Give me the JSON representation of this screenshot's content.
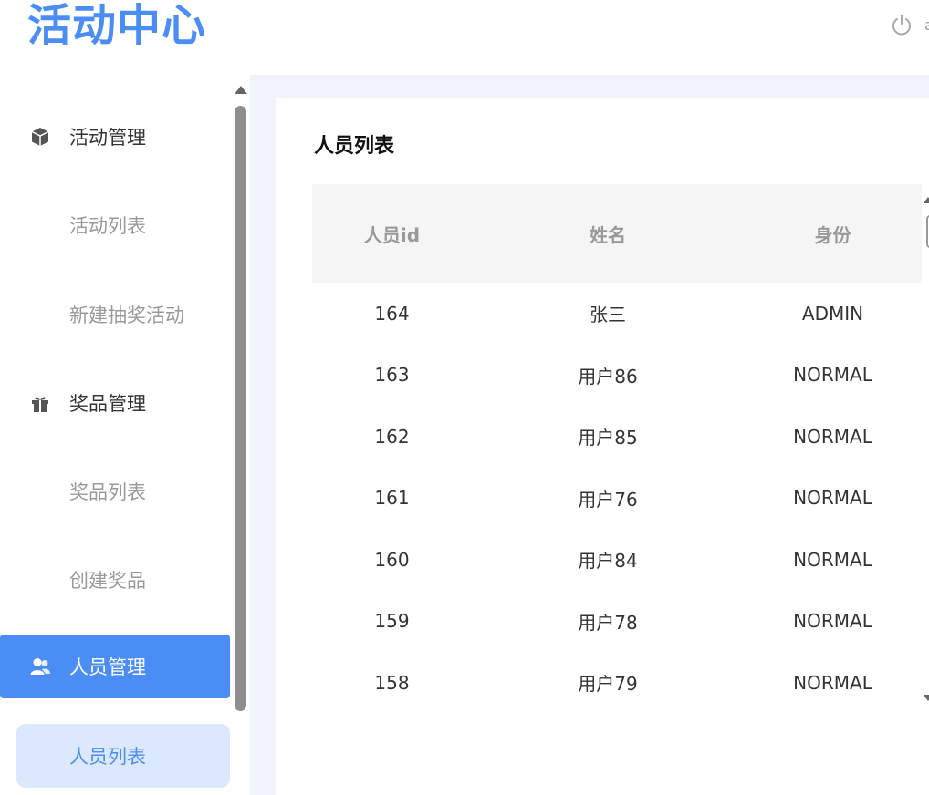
{
  "header": {
    "logo_text": "活动中心",
    "power_icon": "power-icon",
    "user_text": "a"
  },
  "sidebar": {
    "groups": [
      {
        "label": "活动管理",
        "icon": "cube-icon",
        "children": [
          "活动列表",
          "新建抽奖活动"
        ]
      },
      {
        "label": "奖品管理",
        "icon": "gift-icon",
        "children": [
          "奖品列表",
          "创建奖品"
        ]
      },
      {
        "label": "人员管理",
        "icon": "users-icon",
        "children": [
          "人员列表"
        ],
        "active": true
      }
    ],
    "active_sub": "人员列表"
  },
  "main": {
    "title": "人员列表",
    "table": {
      "headers": [
        "人员id",
        "姓名",
        "身份"
      ],
      "rows": [
        [
          "164",
          "张三",
          "ADMIN"
        ],
        [
          "163",
          "用户86",
          "NORMAL"
        ],
        [
          "162",
          "用户85",
          "NORMAL"
        ],
        [
          "161",
          "用户76",
          "NORMAL"
        ],
        [
          "160",
          "用户84",
          "NORMAL"
        ],
        [
          "159",
          "用户78",
          "NORMAL"
        ],
        [
          "158",
          "用户79",
          "NORMAL"
        ]
      ]
    }
  },
  "colors": {
    "accent": "#4a8ef5",
    "active_sub_bg": "#dbe8fd",
    "content_bg": "#f0f3f9",
    "table_header_bg": "#f5f5f5"
  }
}
